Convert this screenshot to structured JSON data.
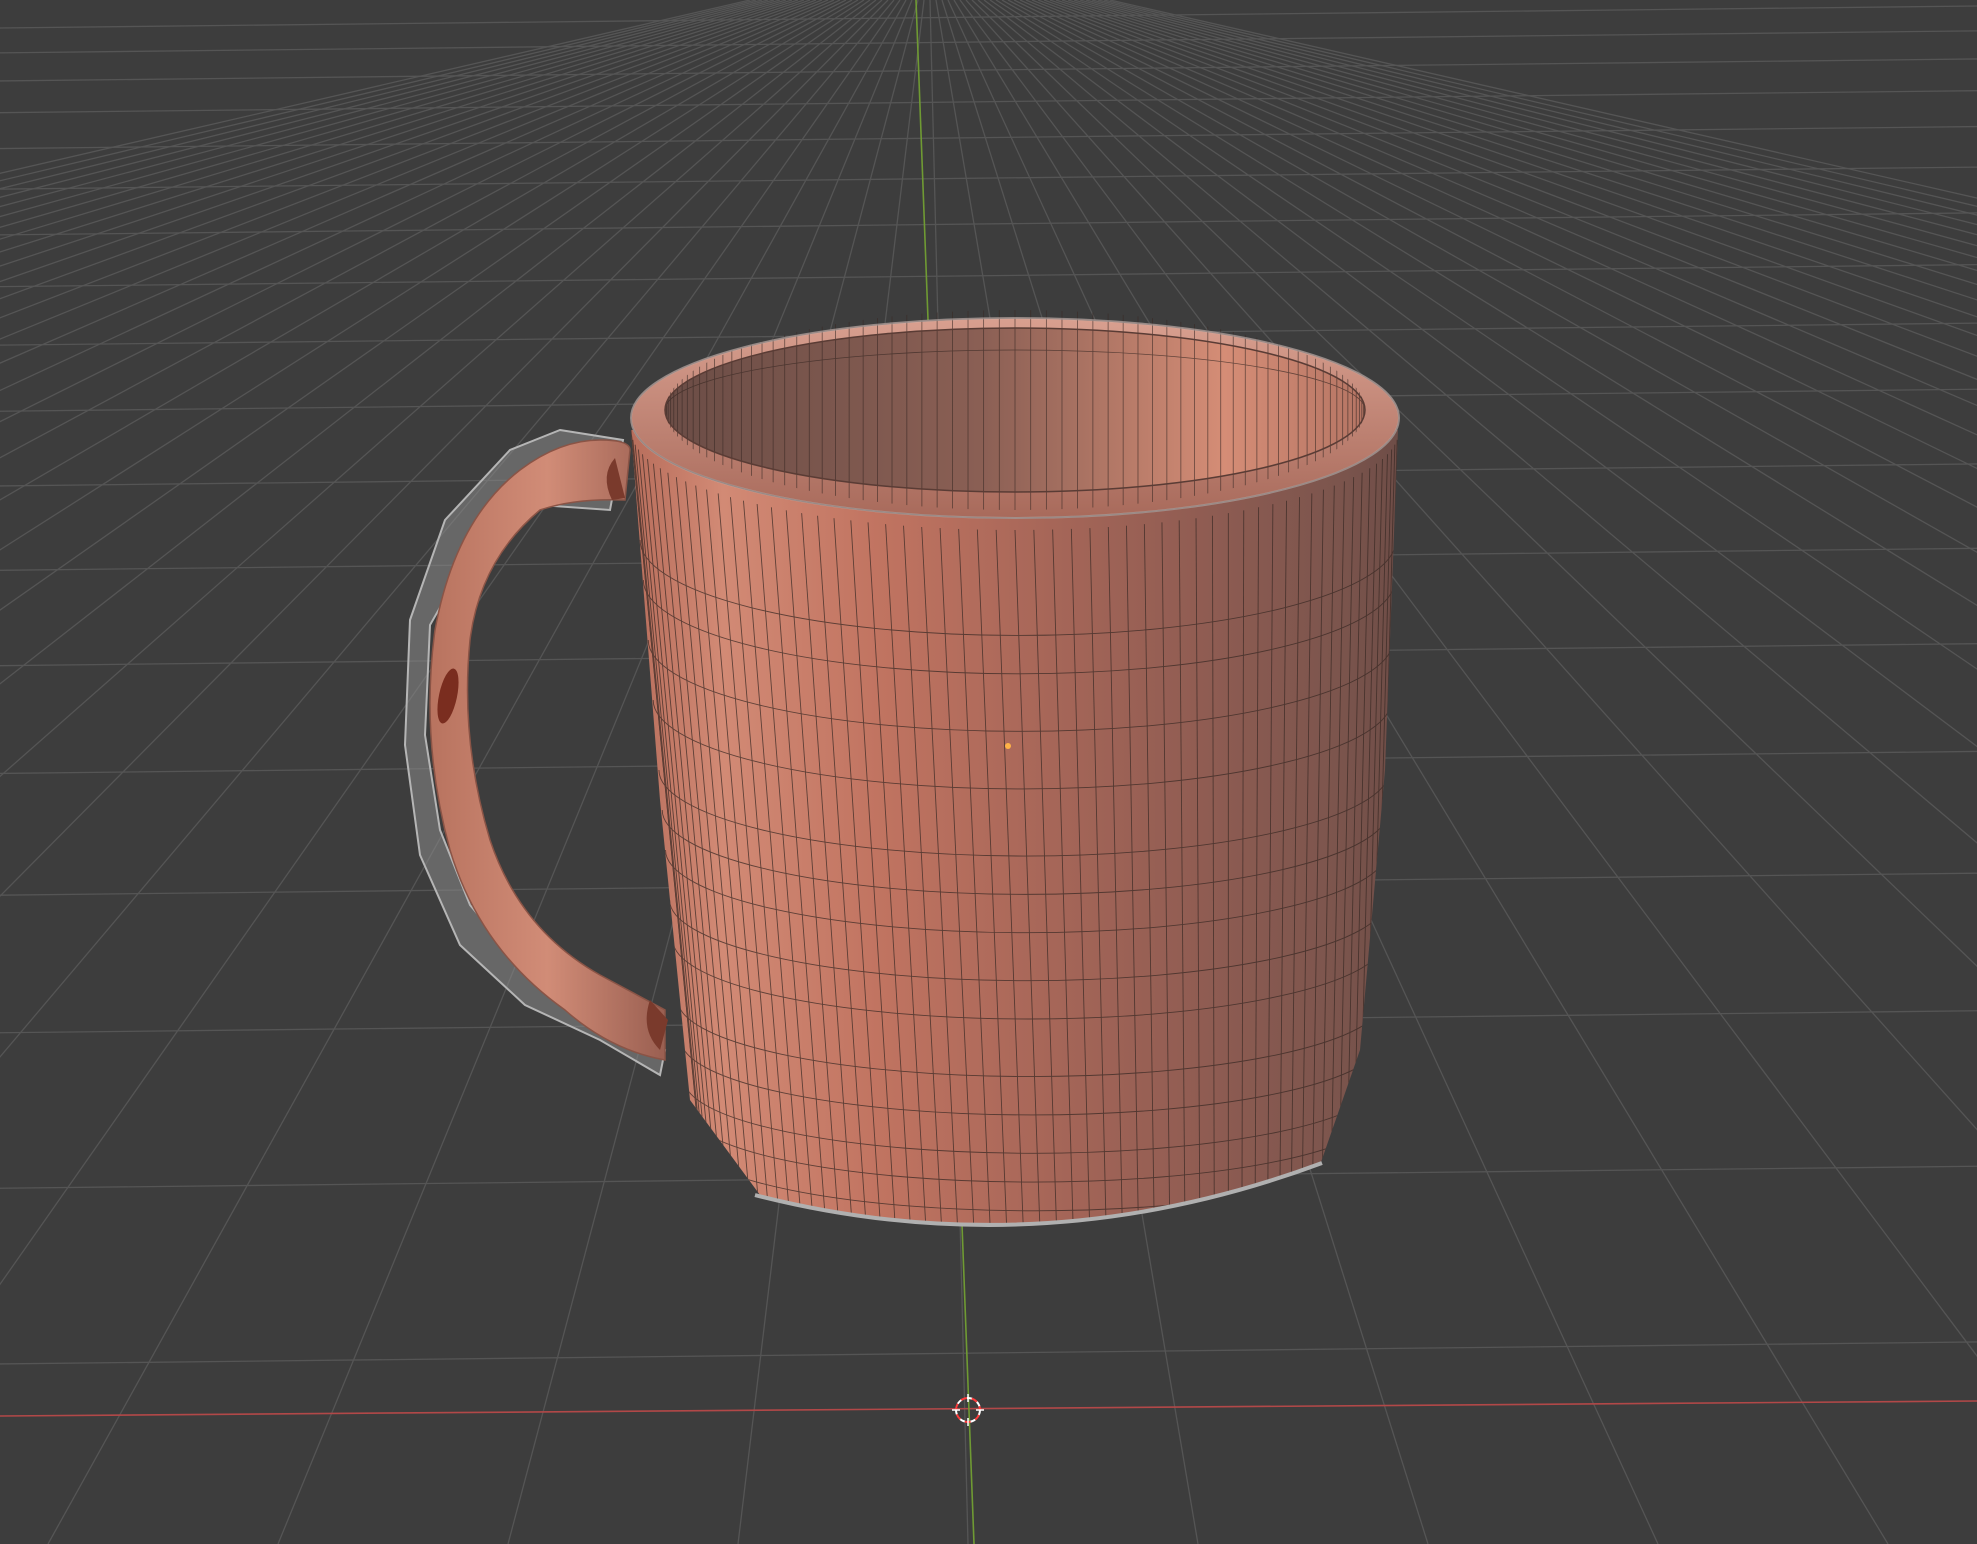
{
  "viewport": {
    "background": "#3d3d3d",
    "grid_color": "#555555",
    "x_axis_color": "#b24848",
    "y_axis_color": "#6f9a33",
    "object_name": "mug",
    "object_color": "#c97b66",
    "cage_color": "#a8a8a8",
    "wire_color": "#3a2a25",
    "origin_color": "#ffb347",
    "cursor_primary": "#ffffff",
    "cursor_secondary": "#ff3b3b"
  }
}
